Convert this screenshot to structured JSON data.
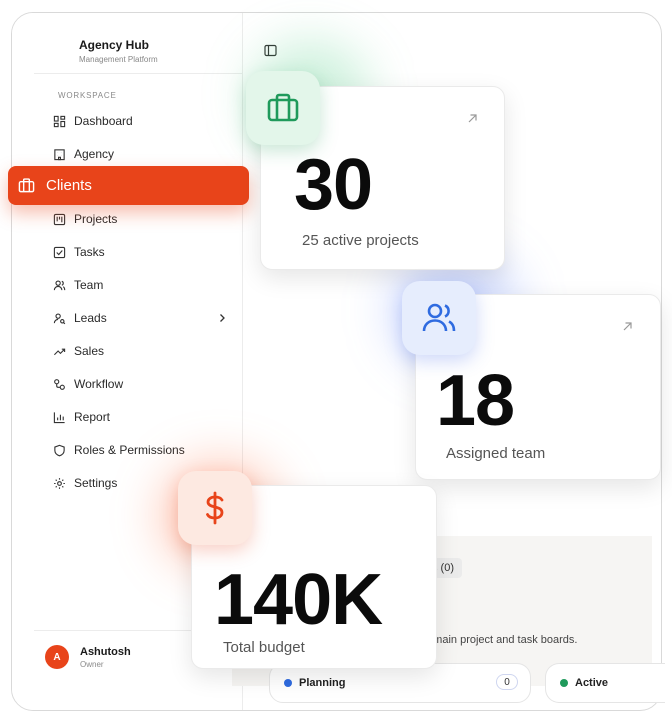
{
  "brand": {
    "title": "Agency Hub",
    "subtitle": "Management Platform"
  },
  "sidebar": {
    "section_label": "WORKSPACE",
    "items": [
      {
        "label": "Dashboard",
        "icon": "dashboard-icon"
      },
      {
        "label": "Agency",
        "icon": "building-icon"
      },
      {
        "label": "Clients",
        "icon": "briefcase-icon",
        "active": true
      },
      {
        "label": "Projects",
        "icon": "kanban-icon"
      },
      {
        "label": "Tasks",
        "icon": "checkbox-icon"
      },
      {
        "label": "Team",
        "icon": "users-icon"
      },
      {
        "label": "Leads",
        "icon": "user-search-icon",
        "has_submenu": true
      },
      {
        "label": "Sales",
        "icon": "trending-up-icon"
      },
      {
        "label": "Workflow",
        "icon": "workflow-icon"
      },
      {
        "label": "Report",
        "icon": "bar-chart-icon"
      },
      {
        "label": "Roles & Permissions",
        "icon": "shield-icon"
      },
      {
        "label": "Settings",
        "icon": "gear-icon"
      }
    ]
  },
  "user": {
    "initial": "A",
    "name": "Ashutosh",
    "role": "Owner"
  },
  "stats": [
    {
      "value": "30",
      "caption": "25 active projects",
      "icon": "briefcase-icon",
      "accent": "#1f9a5b"
    },
    {
      "value": "18",
      "caption": "Assigned team",
      "icon": "users-icon",
      "accent": "#2f6be0"
    },
    {
      "value": "140K",
      "caption": "Total budget",
      "icon": "dollar-icon",
      "accent": "#e8441a"
    }
  ],
  "board": {
    "tab_fragment": "s (0)",
    "description_fragment": "e main project and task boards.",
    "columns": [
      {
        "label": "Planning",
        "count": "0",
        "dot_color": "#2f6be0"
      },
      {
        "label": "Active",
        "dot_color": "#1f9a5b"
      }
    ]
  },
  "colors": {
    "accent": "#e8441a",
    "green": "#1f9a5b",
    "blue": "#2f6be0"
  }
}
